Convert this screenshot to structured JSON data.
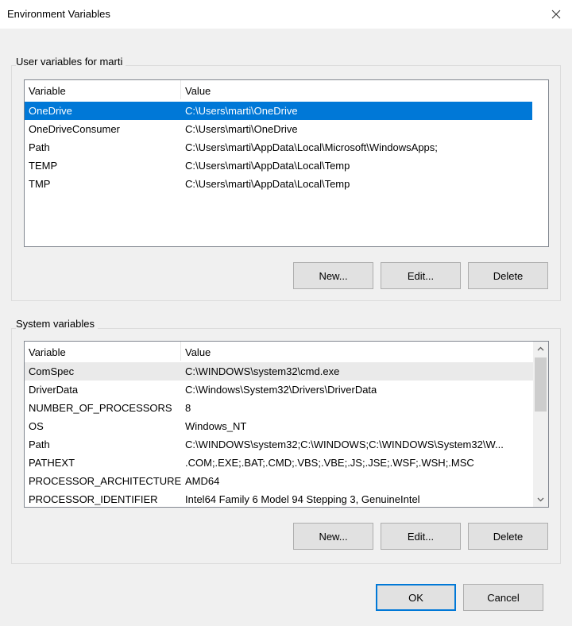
{
  "window": {
    "title": "Environment Variables"
  },
  "user": {
    "group_label": "User variables for marti",
    "headers": {
      "variable": "Variable",
      "value": "Value"
    },
    "rows": [
      {
        "variable": "OneDrive",
        "value": "C:\\Users\\marti\\OneDrive"
      },
      {
        "variable": "OneDriveConsumer",
        "value": "C:\\Users\\marti\\OneDrive"
      },
      {
        "variable": "Path",
        "value": "C:\\Users\\marti\\AppData\\Local\\Microsoft\\WindowsApps;"
      },
      {
        "variable": "TEMP",
        "value": "C:\\Users\\marti\\AppData\\Local\\Temp"
      },
      {
        "variable": "TMP",
        "value": "C:\\Users\\marti\\AppData\\Local\\Temp"
      }
    ],
    "buttons": {
      "new": "New...",
      "edit": "Edit...",
      "delete": "Delete"
    }
  },
  "system": {
    "group_label": "System variables",
    "headers": {
      "variable": "Variable",
      "value": "Value"
    },
    "rows": [
      {
        "variable": "ComSpec",
        "value": "C:\\WINDOWS\\system32\\cmd.exe"
      },
      {
        "variable": "DriverData",
        "value": "C:\\Windows\\System32\\Drivers\\DriverData"
      },
      {
        "variable": "NUMBER_OF_PROCESSORS",
        "value": "8"
      },
      {
        "variable": "OS",
        "value": "Windows_NT"
      },
      {
        "variable": "Path",
        "value": "C:\\WINDOWS\\system32;C:\\WINDOWS;C:\\WINDOWS\\System32\\W..."
      },
      {
        "variable": "PATHEXT",
        "value": ".COM;.EXE;.BAT;.CMD;.VBS;.VBE;.JS;.JSE;.WSF;.WSH;.MSC"
      },
      {
        "variable": "PROCESSOR_ARCHITECTURE",
        "value": "AMD64"
      },
      {
        "variable": "PROCESSOR_IDENTIFIER",
        "value": "Intel64 Family 6 Model 94 Stepping 3, GenuineIntel"
      }
    ],
    "buttons": {
      "new": "New...",
      "edit": "Edit...",
      "delete": "Delete"
    }
  },
  "footer": {
    "ok": "OK",
    "cancel": "Cancel"
  },
  "icons": {
    "close": "close-icon",
    "scroll_up": "chevron-up-icon",
    "scroll_down": "chevron-down-icon"
  },
  "colors": {
    "selection": "#0078d7",
    "focus_border": "#0078d7"
  }
}
